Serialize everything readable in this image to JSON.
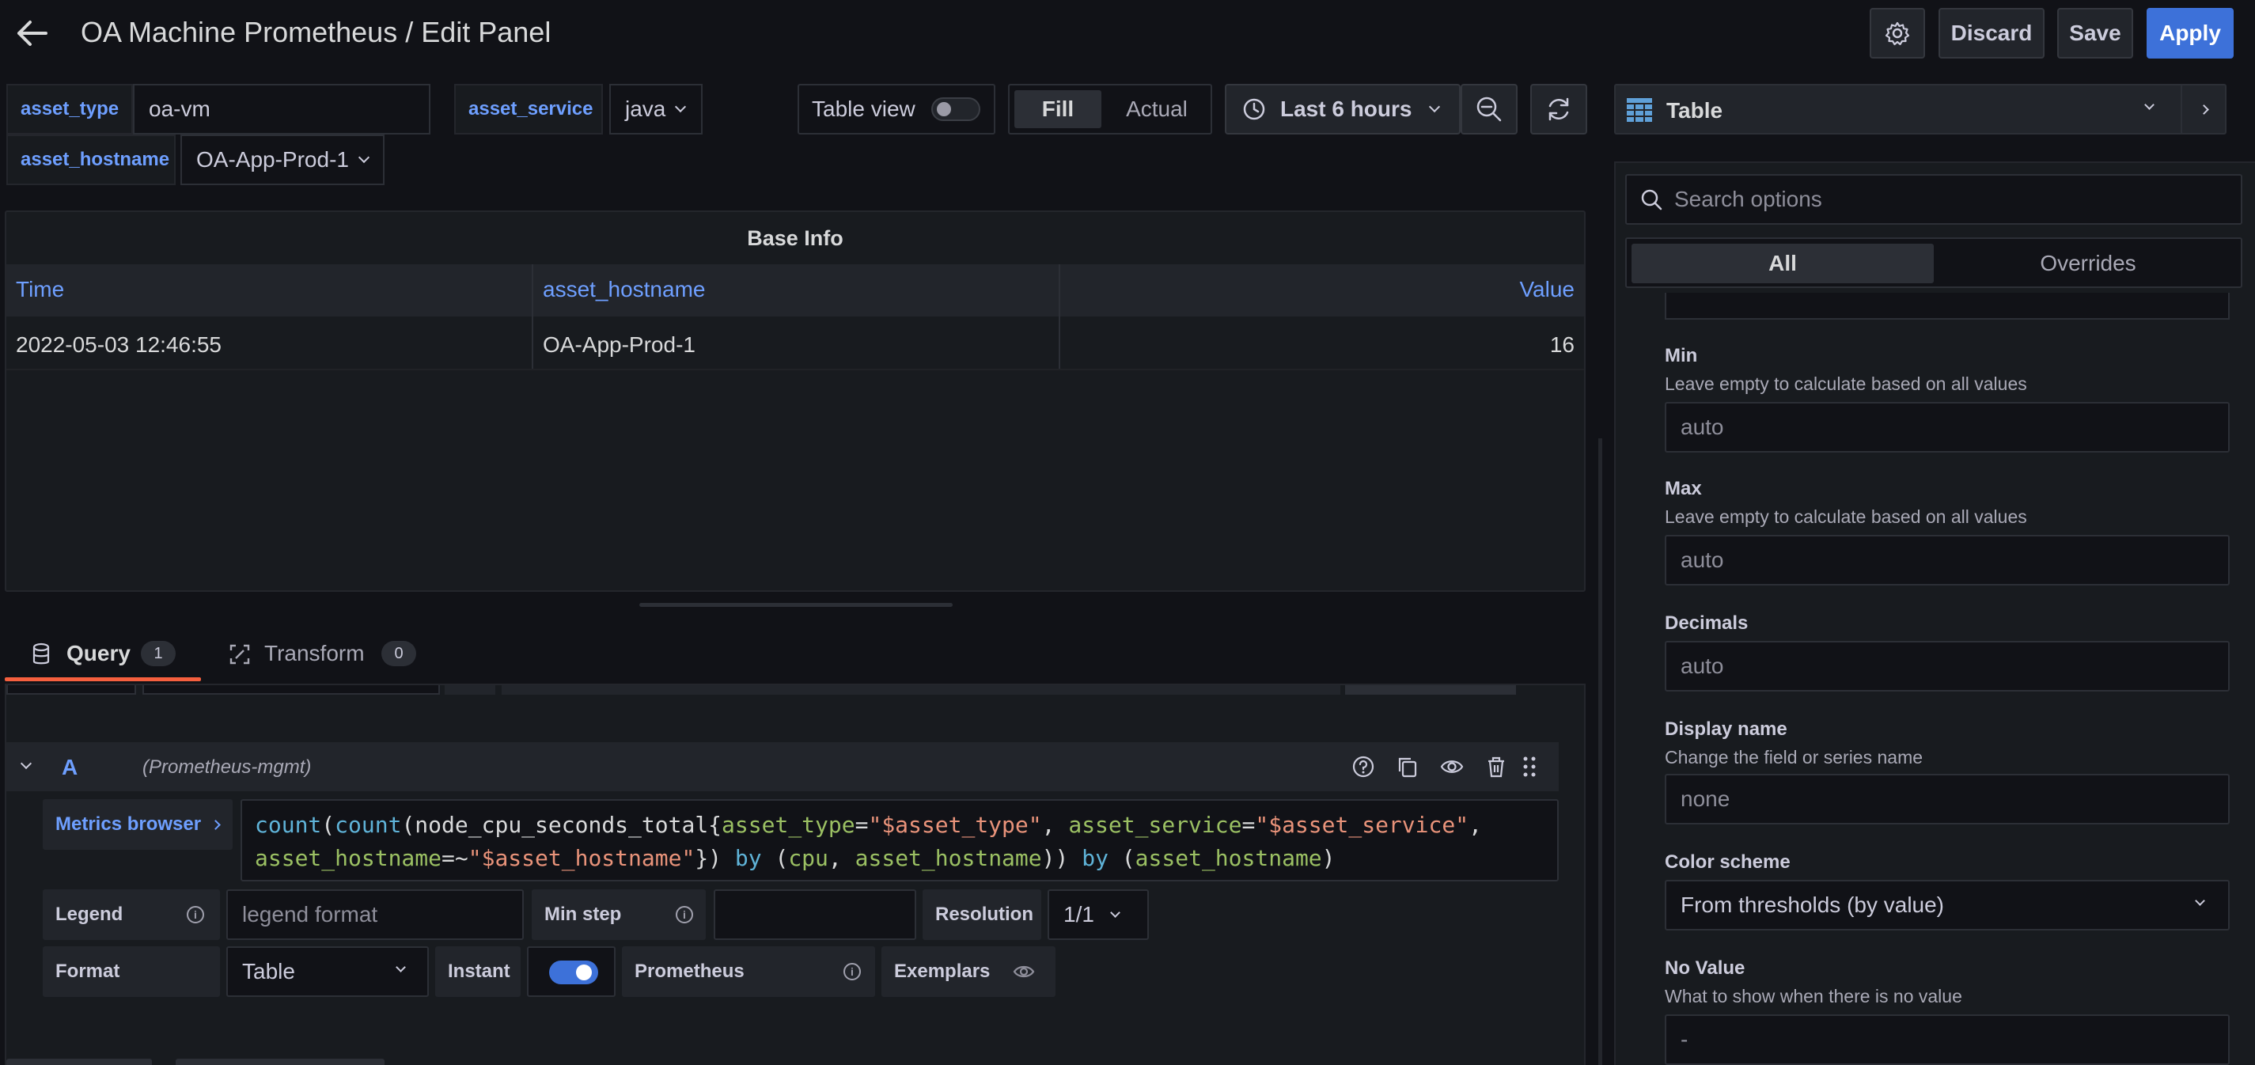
{
  "header": {
    "title": "OA Machine Prometheus / Edit Panel",
    "discard_label": "Discard",
    "save_label": "Save",
    "apply_label": "Apply"
  },
  "variables": [
    {
      "label": "asset_type",
      "value": "oa-vm"
    },
    {
      "label": "asset_service",
      "value": "java"
    },
    {
      "label": "asset_hostname",
      "value": "OA-App-Prod-1"
    }
  ],
  "toolbar": {
    "table_view_label": "Table view",
    "table_view_on": false,
    "fill_label": "Fill",
    "actual_label": "Actual",
    "time_range": "Last 6 hours"
  },
  "panel": {
    "title": "Base Info",
    "columns": [
      "Time",
      "asset_hostname",
      "Value"
    ],
    "rows": [
      [
        "2022-05-03 12:46:55",
        "OA-App-Prod-1",
        "16"
      ]
    ]
  },
  "query_tabs": {
    "query_label": "Query",
    "query_count": "1",
    "transform_label": "Transform",
    "transform_count": "0"
  },
  "query": {
    "ref_id": "A",
    "datasource": "(Prometheus-mgmt)",
    "metrics_browser_label": "Metrics browser",
    "expr_line1": [
      {
        "t": "count",
        "c": "fn"
      },
      {
        "t": "(",
        "c": "txt"
      },
      {
        "t": "count",
        "c": "fn"
      },
      {
        "t": "(node_cpu_seconds_total{",
        "c": "txt"
      },
      {
        "t": "asset_type",
        "c": "lbl"
      },
      {
        "t": "=",
        "c": "txt"
      },
      {
        "t": "\"$asset_type\"",
        "c": "str"
      },
      {
        "t": ", ",
        "c": "txt"
      },
      {
        "t": "asset_service",
        "c": "lbl"
      },
      {
        "t": "=",
        "c": "txt"
      },
      {
        "t": "\"$asset_service\"",
        "c": "str"
      },
      {
        "t": ",",
        "c": "txt"
      }
    ],
    "expr_line2": [
      {
        "t": "asset_hostname",
        "c": "lbl"
      },
      {
        "t": "=~",
        "c": "txt"
      },
      {
        "t": "\"$asset_hostname\"",
        "c": "str"
      },
      {
        "t": "}) ",
        "c": "txt"
      },
      {
        "t": "by",
        "c": "kw"
      },
      {
        "t": " (",
        "c": "txt"
      },
      {
        "t": "cpu",
        "c": "lbl"
      },
      {
        "t": ", ",
        "c": "txt"
      },
      {
        "t": "asset_hostname",
        "c": "lbl"
      },
      {
        "t": ")) ",
        "c": "txt"
      },
      {
        "t": "by",
        "c": "kw"
      },
      {
        "t": " (",
        "c": "txt"
      },
      {
        "t": "asset_hostname",
        "c": "lbl"
      },
      {
        "t": ")",
        "c": "txt"
      }
    ],
    "legend_label": "Legend",
    "legend_placeholder": "legend format",
    "min_step_label": "Min step",
    "resolution_label": "Resolution",
    "resolution_value": "1/1",
    "format_label": "Format",
    "format_value": "Table",
    "instant_label": "Instant",
    "instant_on": true,
    "prometheus_label": "Prometheus",
    "exemplars_label": "Exemplars"
  },
  "options": {
    "viz_name": "Table",
    "search_placeholder": "Search options",
    "tab_all": "All",
    "tab_overrides": "Overrides",
    "min_title": "Min",
    "min_desc": "Leave empty to calculate based on all values",
    "min_placeholder": "auto",
    "max_title": "Max",
    "max_desc": "Leave empty to calculate based on all values",
    "max_placeholder": "auto",
    "decimals_title": "Decimals",
    "decimals_placeholder": "auto",
    "display_name_title": "Display name",
    "display_name_desc": "Change the field or series name",
    "display_name_placeholder": "none",
    "color_scheme_title": "Color scheme",
    "color_scheme_value": "From thresholds (by value)",
    "no_value_title": "No Value",
    "no_value_desc": "What to show when there is no value",
    "no_value_placeholder": "-"
  },
  "colors": {
    "accent": "#3d71d9",
    "link": "#6e9fff",
    "tab_underline": "#f55f3e"
  }
}
